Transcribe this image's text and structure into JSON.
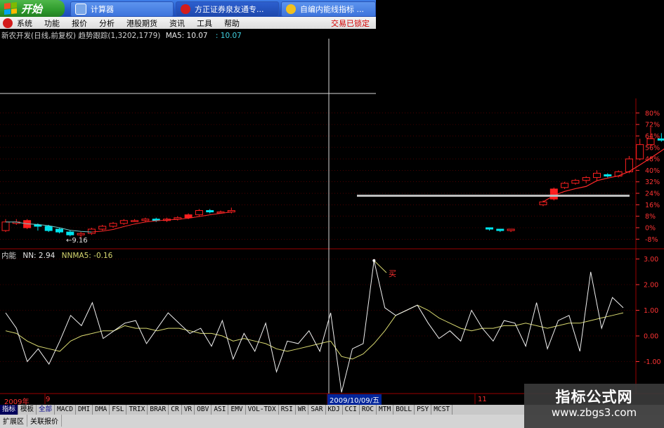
{
  "taskbar": {
    "start_label": "开始",
    "tasks": [
      "计算器",
      "方正证券泉友通专...",
      "自编内能线指标 ..."
    ]
  },
  "menubar": {
    "items": [
      "系统",
      "功能",
      "报价",
      "分析",
      "港股期货",
      "资讯",
      "工具",
      "帮助"
    ],
    "trade_status": "交易已锁定"
  },
  "chart_header": {
    "stock": "新农开发(日线,前复权)",
    "indicator": "趋势跟踪(1,3202,1779)",
    "ma_label": "MA5: 10.07",
    "ma_value2": ": 10.07"
  },
  "indicator_header": {
    "name": "内能",
    "nn": "NN: 2.94",
    "nnma": "NNMA5: -0.16"
  },
  "annotations": {
    "low_label": "←9.16",
    "indicator_note": "买"
  },
  "date_axis": {
    "year": "2009年",
    "month": "9",
    "cursor_date": "2009/10/09/五",
    "month2": "11"
  },
  "tabs": {
    "left": [
      "指标",
      "模板",
      "全部"
    ],
    "indicators": [
      "MACD",
      "DMI",
      "DMA",
      "FSL",
      "TRIX",
      "BRAR",
      "CR",
      "VR",
      "OBV",
      "ASI",
      "EMV",
      "VOL-TDX",
      "RSI",
      "WR",
      "SAR",
      "KDJ",
      "CCI",
      "ROC",
      "MTM",
      "BOLL",
      "PSY",
      "MCST"
    ]
  },
  "extbar": [
    "扩展区",
    "关联报价"
  ],
  "watermark": {
    "title": "指标公式网",
    "url": "www.zbgs3.com"
  },
  "colors": {
    "up": "#ff2020",
    "down": "#00e5ee",
    "ma": "#ff2a2a",
    "nn": "#f2f2f2",
    "nnma": "#d8d870",
    "grid": "#7a0000",
    "axis_text": "#ff3333"
  },
  "chart_data": [
    {
      "type": "candlestick",
      "title": "新农开发(日线,前复权)",
      "y_axis_ticks": [
        "80%",
        "72%",
        "64%",
        "56%",
        "48%",
        "40%",
        "32%",
        "24%",
        "16%",
        "8%",
        "0%",
        "-8%"
      ],
      "series": [
        {
          "name": "candles",
          "values": [
            [
              -2,
              4,
              -3,
              6,
              1
            ],
            [
              3,
              4,
              2,
              6,
              1
            ],
            [
              5,
              0,
              -1,
              6,
              1
            ],
            [
              2,
              1,
              -2,
              3,
              0
            ],
            [
              1,
              -2,
              -3,
              2,
              0
            ],
            [
              -1,
              -3,
              -4,
              0,
              0
            ],
            [
              -3,
              -5,
              -6,
              -2,
              0
            ],
            [
              -5,
              -4,
              -7,
              -3,
              1
            ],
            [
              -4,
              -1,
              -5,
              0,
              1
            ],
            [
              -1,
              1,
              -2,
              2,
              1
            ],
            [
              1,
              3,
              0,
              4,
              1
            ],
            [
              3,
              5,
              2,
              6,
              1
            ],
            [
              5,
              5,
              4,
              6,
              1
            ],
            [
              5,
              6,
              4,
              7,
              1
            ],
            [
              6,
              5,
              4,
              7,
              0
            ],
            [
              5,
              6,
              4,
              7,
              1
            ],
            [
              6,
              7,
              5,
              8,
              1
            ],
            [
              7,
              9,
              6,
              10,
              1
            ],
            [
              9,
              12,
              8,
              13,
              1
            ],
            [
              12,
              11,
              10,
              13,
              0
            ],
            [
              11,
              11,
              10,
              12,
              1
            ],
            [
              11,
              12,
              10,
              14,
              1
            ],
            null,
            null,
            null,
            null,
            null,
            null,
            null,
            null,
            null,
            null,
            null,
            null,
            null,
            null,
            null,
            null,
            null,
            null,
            null,
            null,
            null,
            null,
            null,
            [
              0,
              -1,
              -2,
              0,
              0
            ],
            [
              -1,
              -2,
              -3,
              -1,
              0
            ],
            [
              -2,
              -1,
              -3,
              -1,
              1
            ],
            null,
            null,
            [
              16,
              18,
              15,
              19,
              1
            ],
            [
              20,
              27,
              19,
              28,
              1
            ],
            [
              28,
              31,
              27,
              32,
              1
            ],
            [
              31,
              33,
              30,
              34,
              1
            ],
            [
              33,
              35,
              31,
              36,
              1
            ],
            [
              35,
              38,
              33,
              40,
              1
            ],
            [
              37,
              36,
              35,
              38,
              0
            ],
            [
              36,
              39,
              35,
              40,
              1
            ],
            [
              39,
              48,
              38,
              50,
              1
            ],
            [
              48,
              58,
              47,
              62,
              1
            ],
            [
              58,
              62,
              57,
              70,
              1
            ],
            [
              62,
              61,
              60,
              66,
              0
            ],
            [
              61,
              66,
              60,
              68,
              1
            ],
            [
              66,
              68,
              65,
              70,
              1
            ],
            [
              67,
              66,
              64,
              68,
              0
            ],
            [
              66,
              72,
              65,
              74,
              1
            ],
            [
              72,
              70,
              68,
              74,
              0
            ],
            [
              70,
              73,
              69,
              74,
              1
            ],
            [
              73,
              74,
              71,
              75,
              1
            ],
            [
              74,
              75,
              73,
              76,
              0
            ],
            [
              75,
              75,
              73,
              76,
              1
            ],
            [
              75,
              82,
              74,
              86,
              1
            ]
          ]
        },
        {
          "name": "MA5",
          "values": "trend"
        }
      ]
    },
    {
      "type": "line",
      "title": "内能",
      "y_axis_ticks": [
        "3.00",
        "2.00",
        "1.00",
        "0.00",
        "-1.00"
      ],
      "series": [
        {
          "name": "NN",
          "values": [
            0.9,
            0.3,
            -1.0,
            -0.5,
            -1.1,
            -0.2,
            0.8,
            0.4,
            1.3,
            -0.1,
            0.2,
            0.5,
            0.6,
            -0.3,
            0.3,
            0.9,
            0.5,
            0.1,
            0.3,
            -0.4,
            0.6,
            -0.9,
            0.1,
            -0.6,
            0.5,
            -1.4,
            -0.2,
            -0.3,
            0.2,
            -0.6,
            0.9,
            -2.2,
            -0.5,
            -0.3,
            2.94,
            1.1,
            0.8,
            1.0,
            1.2,
            0.5,
            -0.1,
            0.2,
            -0.2,
            1.0,
            0.3,
            -0.2,
            0.6,
            0.5,
            -0.4,
            1.3,
            -0.5,
            0.6,
            0.8,
            -0.6,
            2.5,
            0.3,
            1.5,
            1.1
          ]
        },
        {
          "name": "NNMA5",
          "values": [
            0.2,
            0.1,
            -0.2,
            -0.4,
            -0.5,
            -0.6,
            -0.2,
            0.0,
            0.1,
            0.2,
            0.2,
            0.4,
            0.3,
            0.3,
            0.2,
            0.3,
            0.3,
            0.2,
            0.1,
            0.1,
            0.0,
            -0.2,
            -0.1,
            -0.2,
            -0.3,
            -0.5,
            -0.6,
            -0.5,
            -0.4,
            -0.3,
            -0.2,
            -0.8,
            -0.9,
            -0.7,
            -0.3,
            0.2,
            0.8,
            1.0,
            1.2,
            1.0,
            0.7,
            0.5,
            0.3,
            0.2,
            0.3,
            0.3,
            0.4,
            0.4,
            0.5,
            0.4,
            0.3,
            0.4,
            0.5,
            0.5,
            0.6,
            0.7,
            0.8,
            0.9
          ]
        }
      ]
    }
  ]
}
